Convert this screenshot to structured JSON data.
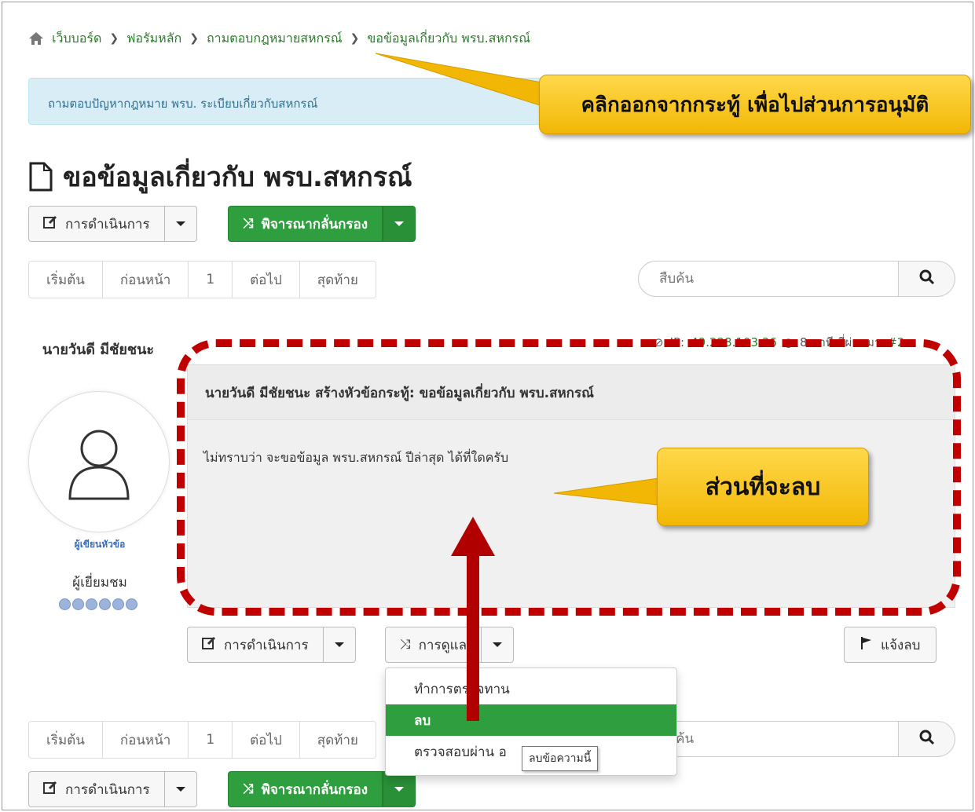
{
  "breadcrumb": {
    "items": [
      "เว็บบอร์ด",
      "ฟอรัมหลัก",
      "ถามตอบกฎหมายสหกรณ์",
      "ขอข้อมูลเกี่ยวกับ พรบ.สหกรณ์"
    ]
  },
  "info_banner": "ถามตอบปัญหากฎหมาย พรบ. ระเบียบเกี่ยวกับสหกรณ์",
  "annotations": {
    "top_callout": "คลิกออกจากกระทู้ เพื่อไปส่วนการอนุมัติ",
    "delete_callout": "ส่วนที่จะลบ"
  },
  "page_title": "ขอข้อมูลเกี่ยวกับ พรบ.สหกรณ์",
  "toolbar": {
    "actions_label": "การดำเนินการ",
    "moderate_label": "พิจารณากลั่นกรอง"
  },
  "pagination": {
    "first": "เริ่มต้น",
    "prev": "ก่อนหน้า",
    "current": "1",
    "next": "ต่อไป",
    "last": "สุดท้าย"
  },
  "search": {
    "placeholder": "สืบค้น"
  },
  "post": {
    "ip_label": "IP:",
    "ip": "49.228.103.36",
    "time": "8 นาที ที่ผ่านมา",
    "number": "#2",
    "author_name": "นายวันดี มีชัยชนะ",
    "author_role": "ผู้เขียนหัวข้อ",
    "author_rank": "ผู้เยี่ยมชม",
    "rank_dots": 6,
    "header": "นายวันดี มีชัยชนะ สร้างหัวข้อกระทู้: ขอข้อมูลเกี่ยวกับ พรบ.สหกรณ์",
    "body": "ไม่ทราบว่า จะขอข้อมูล พรบ.สหกรณ์ ปีล่าสุด ได้ที่ใดครับ"
  },
  "post_toolbar": {
    "actions_label": "การดำเนินการ",
    "manage_label": "การดูแล",
    "report_label": "แจ้งลบ"
  },
  "dropdown": {
    "items": [
      "ทำการตรวจทาน",
      "ลบ",
      "ตรวจสอบผ่าน อ"
    ],
    "tooltip": "ลบข้อความนี้"
  },
  "colors": {
    "green": "#2f9e3e",
    "link": "#2d7a2d",
    "callout": "#f2b705",
    "outline": "#c00000"
  }
}
